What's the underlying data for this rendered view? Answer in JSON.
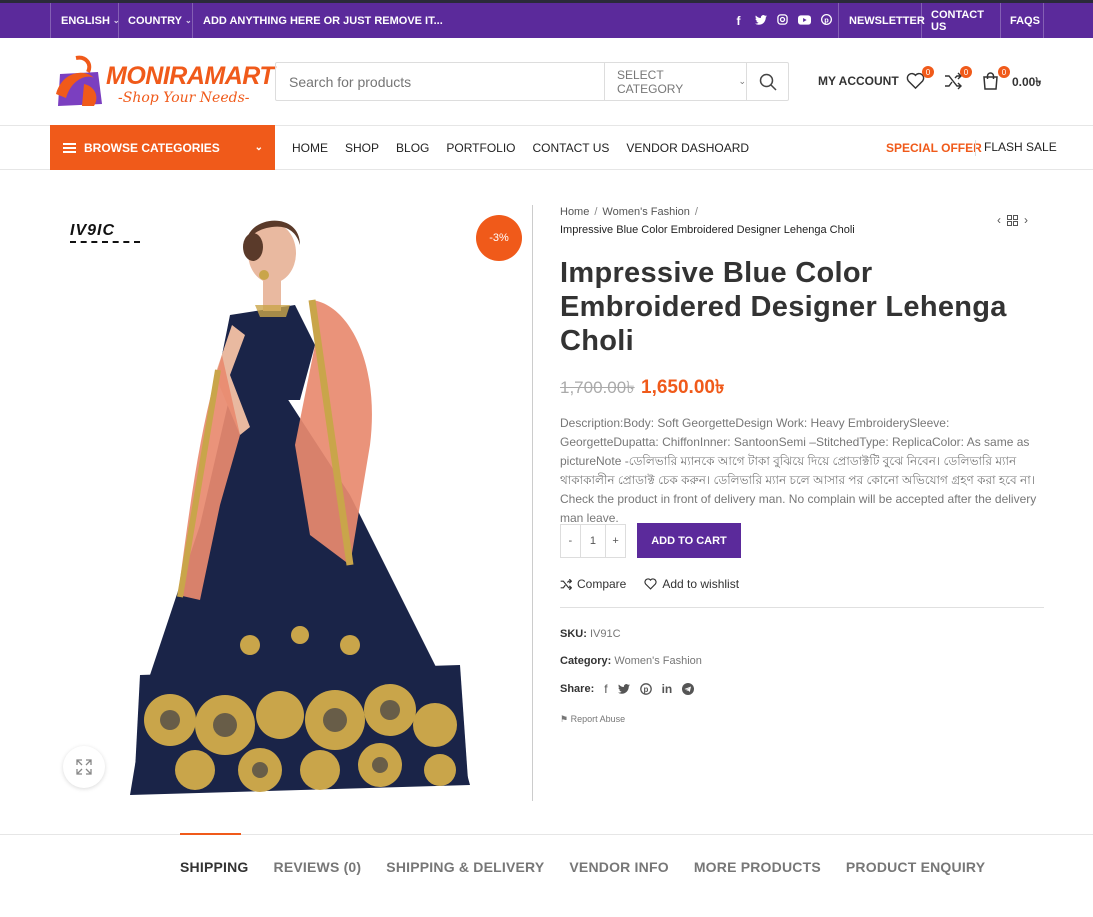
{
  "topbar": {
    "language": "ENGLISH",
    "country": "COUNTRY",
    "promo": "ADD ANYTHING HERE OR JUST REMOVE IT...",
    "links": [
      "NEWSLETTER",
      "CONTACT US",
      "FAQS"
    ],
    "social_icons": [
      "facebook-icon",
      "twitter-icon",
      "instagram-icon",
      "youtube-icon",
      "pinterest-icon"
    ],
    "bg_color": "#5b2a9b"
  },
  "header": {
    "logo_name": "MONIRAMART",
    "logo_tagline": "-Shop Your Needs-",
    "search_placeholder": "Search for products",
    "category_select": "SELECT CATEGORY",
    "account_label": "MY ACCOUNT",
    "wishlist_count": "0",
    "compare_count": "0",
    "cart_count": "0",
    "cart_total": "0.00৳"
  },
  "nav": {
    "browse_label": "BROWSE CATEGORIES",
    "items": [
      "HOME",
      "SHOP",
      "BLOG",
      "PORTFOLIO",
      "CONTACT US",
      "VENDOR DASHOARD"
    ],
    "special_offer": "SPECIAL OFFER",
    "flash_sale": "FLASH SALE",
    "accent_color": "#f05a1a"
  },
  "gallery": {
    "brand_mark": "IV9IC",
    "discount_badge": "-3%"
  },
  "product": {
    "breadcrumb": [
      "Home",
      "Women's Fashion"
    ],
    "breadcrumb_current": "Impressive Blue Color Embroidered Designer Lehenga Choli",
    "title": "Impressive Blue Color Embroidered Designer Lehenga Choli",
    "price_old": "1,700.00৳",
    "price_new": "1,650.00৳",
    "description": "Description:Body: Soft GeorgetteDesign Work: Heavy EmbroiderySleeve: GeorgetteDupatta: ChiffonInner: SantoonSemi –StitchedType: ReplicaColor: As same as pictureNote -ডেলিভারি ম্যানকে আগে টাকা বুঝিয়ে দিয়ে প্রোডাক্টটি বুঝে নিবেন। ডেলিভারি ম্যান থাকাকালীন প্রোডাক্ট চেক করুন। ডেলিভারি ম্যান চলে আসার পর কোনো অভিযোগ গ্রহণ করা হবে না।Check the product in front of delivery man. No complain will be accepted after the delivery man leave.",
    "qty_minus": "-",
    "qty_value": "1",
    "qty_plus": "+",
    "add_to_cart": "ADD TO CART",
    "compare": "Compare",
    "wishlist": "Add to wishlist",
    "sku_label": "SKU:",
    "sku_value": "IV91C",
    "category_label": "Category:",
    "category_value": "Women's Fashion",
    "share_label": "Share:",
    "share_icons": [
      "facebook-icon",
      "twitter-icon",
      "pinterest-icon",
      "linkedin-icon",
      "telegram-icon"
    ],
    "report_abuse": "Report Abuse"
  },
  "tabs": [
    "SHIPPING",
    "REVIEWS (0)",
    "SHIPPING & DELIVERY",
    "VENDOR INFO",
    "MORE PRODUCTS",
    "PRODUCT ENQUIRY"
  ]
}
